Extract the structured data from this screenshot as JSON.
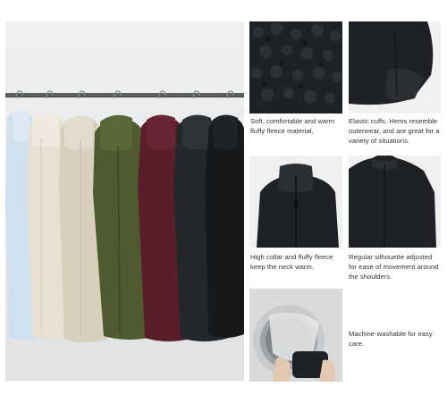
{
  "features": [
    {
      "id": "fleece-texture",
      "caption": "Soft, comfortable and warm fluffy fleece material."
    },
    {
      "id": "elastic-cuffs",
      "caption": "Elastic cuffs. Hems resemble outerwear, and are great for a variety of situations."
    },
    {
      "id": "high-collar",
      "caption": "High collar and fluffy fleece keep the neck warm."
    },
    {
      "id": "regular-silhouette",
      "caption": "Regular silhouette adjusted for ease of movement around the shoulders."
    },
    {
      "id": "machine-washable",
      "caption": "Machine-washable for easy care."
    }
  ],
  "colors": {
    "jackets": [
      "#cfe0ef",
      "#e7e0d3",
      "#d9cfbd",
      "#505a31",
      "#5a1e2a",
      "#23272b",
      "#17191b"
    ],
    "rack": "#5b5e62",
    "fleece_dark": "#1e2226"
  },
  "icons": [
    "clothes-rack",
    "hanger",
    "zipper",
    "washing-machine"
  ]
}
